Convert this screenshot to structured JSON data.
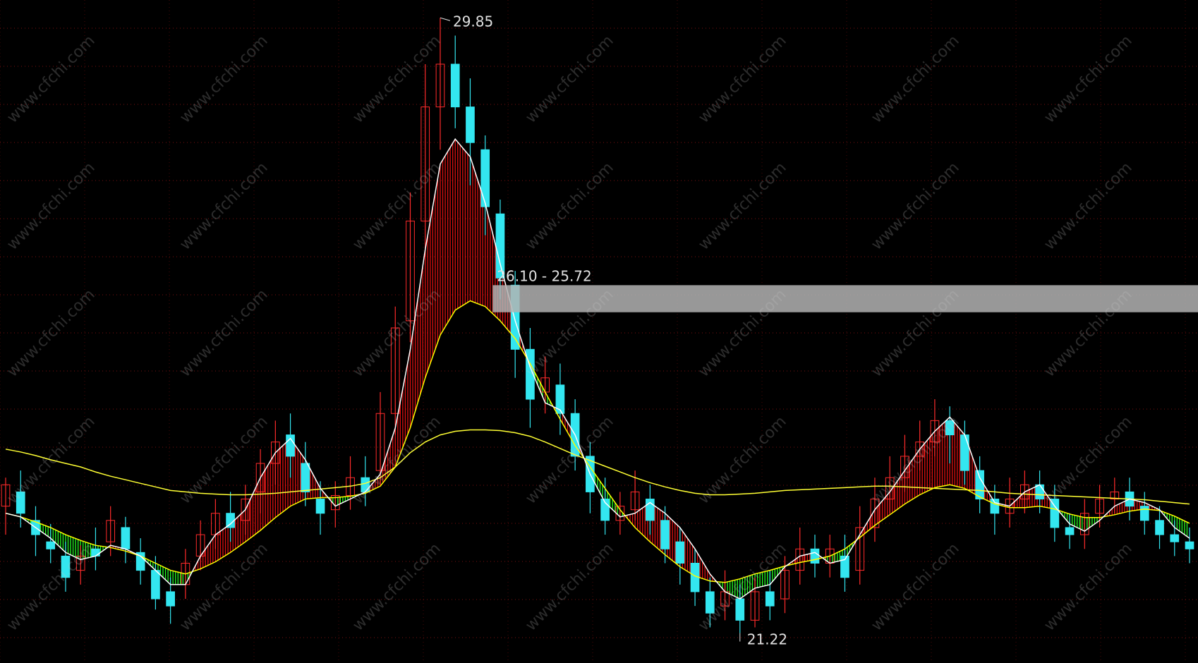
{
  "watermark": "www.cfchi.com",
  "colors": {
    "background": "#000000",
    "grid": "#7a1010",
    "up_candle": "#ff2b2b",
    "down_candle": "#33e6f0",
    "ma_fast": "#ffffff",
    "ma_mid": "#ffff00",
    "ma_slow": "#ffff33",
    "fill_up": "#e01010",
    "fill_down": "#22ff22",
    "zone": "#b3b3b3",
    "label": "#e0e0e0"
  },
  "chart_data": {
    "type": "candlestick",
    "price_range": [
      20.8,
      30.1
    ],
    "annotations": {
      "high": "29.85",
      "low": "21.22",
      "zone": "26.10 - 25.72"
    },
    "zone": {
      "low": 25.72,
      "high": 26.1
    },
    "fast_ma": [
      22.9,
      22.85,
      22.7,
      22.55,
      22.35,
      22.25,
      22.3,
      22.45,
      22.4,
      22.3,
      22.1,
      21.9,
      21.9,
      22.3,
      22.6,
      22.75,
      22.95,
      23.4,
      23.75,
      23.95,
      23.65,
      23.25,
      23.0,
      23.1,
      23.2,
      23.45,
      24.1,
      25.2,
      26.6,
      27.8,
      28.15,
      27.9,
      27.25,
      26.4,
      25.6,
      24.95,
      24.45,
      24.35,
      24.0,
      23.45,
      23.05,
      22.85,
      22.9,
      23.05,
      22.9,
      22.7,
      22.4,
      22.05,
      21.8,
      21.7,
      21.85,
      21.9,
      22.15,
      22.3,
      22.35,
      22.2,
      22.25,
      22.6,
      22.95,
      23.2,
      23.5,
      23.8,
      24.05,
      24.25,
      24.0,
      23.4,
      23.05,
      23.0,
      23.2,
      23.3,
      23.0,
      22.75,
      22.65,
      22.8,
      23.0,
      23.1,
      23.05,
      22.95,
      22.7,
      22.55
    ],
    "mid_ma": [
      22.9,
      22.85,
      22.78,
      22.7,
      22.6,
      22.52,
      22.45,
      22.42,
      22.37,
      22.3,
      22.2,
      22.1,
      22.05,
      22.12,
      22.22,
      22.35,
      22.5,
      22.66,
      22.84,
      23.0,
      23.1,
      23.12,
      23.12,
      23.14,
      23.18,
      23.28,
      23.55,
      24.1,
      24.8,
      25.4,
      25.75,
      25.88,
      25.8,
      25.6,
      25.35,
      25.0,
      24.6,
      24.22,
      23.85,
      23.55,
      23.25,
      22.95,
      22.7,
      22.5,
      22.32,
      22.15,
      22.02,
      21.95,
      21.93,
      21.98,
      22.05,
      22.1,
      22.16,
      22.21,
      22.25,
      22.3,
      22.4,
      22.56,
      22.73,
      22.88,
      23.03,
      23.16,
      23.26,
      23.3,
      23.25,
      23.13,
      23.03,
      22.98,
      22.98,
      23.0,
      22.96,
      22.89,
      22.84,
      22.84,
      22.88,
      22.93,
      22.96,
      22.94,
      22.86,
      22.76
    ],
    "slow_ma": [
      23.8,
      23.76,
      23.71,
      23.65,
      23.6,
      23.55,
      23.48,
      23.42,
      23.37,
      23.32,
      23.27,
      23.22,
      23.2,
      23.18,
      23.17,
      23.16,
      23.16,
      23.17,
      23.18,
      23.2,
      23.22,
      23.24,
      23.26,
      23.28,
      23.32,
      23.4,
      23.55,
      23.75,
      23.9,
      24.0,
      24.05,
      24.07,
      24.07,
      24.06,
      24.03,
      23.98,
      23.9,
      23.81,
      23.72,
      23.64,
      23.56,
      23.48,
      23.4,
      23.33,
      23.27,
      23.22,
      23.18,
      23.16,
      23.16,
      23.17,
      23.18,
      23.2,
      23.22,
      23.23,
      23.24,
      23.25,
      23.26,
      23.27,
      23.28,
      23.28,
      23.27,
      23.26,
      23.25,
      23.24,
      23.23,
      23.22,
      23.2,
      23.18,
      23.17,
      23.16,
      23.15,
      23.14,
      23.13,
      23.12,
      23.11,
      23.1,
      23.09,
      23.07,
      23.05,
      23.03
    ],
    "candles": [
      [
        23.0,
        23.3,
        23.4,
        22.6
      ],
      [
        23.2,
        22.9,
        23.5,
        22.7
      ],
      [
        22.8,
        22.6,
        23.0,
        22.3
      ],
      [
        22.5,
        22.4,
        22.75,
        22.2
      ],
      [
        22.3,
        22.0,
        22.5,
        21.8
      ],
      [
        22.1,
        22.3,
        22.45,
        21.9
      ],
      [
        22.4,
        22.3,
        22.7,
        22.1
      ],
      [
        22.5,
        22.8,
        23.0,
        22.3
      ],
      [
        22.7,
        22.4,
        22.85,
        22.2
      ],
      [
        22.35,
        22.1,
        22.55,
        21.9
      ],
      [
        22.1,
        21.7,
        22.3,
        21.55
      ],
      [
        21.8,
        21.6,
        22.0,
        21.35
      ],
      [
        21.9,
        22.2,
        22.4,
        21.7
      ],
      [
        22.3,
        22.6,
        22.8,
        22.1
      ],
      [
        22.6,
        22.9,
        23.1,
        22.4
      ],
      [
        22.9,
        22.7,
        23.2,
        22.5
      ],
      [
        22.8,
        23.1,
        23.3,
        22.6
      ],
      [
        23.2,
        23.6,
        23.8,
        22.9
      ],
      [
        23.6,
        23.9,
        24.2,
        23.3
      ],
      [
        24.0,
        23.7,
        24.3,
        23.4
      ],
      [
        23.6,
        23.2,
        23.9,
        23.0
      ],
      [
        23.1,
        22.9,
        23.35,
        22.6
      ],
      [
        22.95,
        23.15,
        23.35,
        22.7
      ],
      [
        23.15,
        23.4,
        23.7,
        22.95
      ],
      [
        23.4,
        23.2,
        23.7,
        23.0
      ],
      [
        23.5,
        24.3,
        24.6,
        23.3
      ],
      [
        24.3,
        25.5,
        25.8,
        24.0
      ],
      [
        25.6,
        27.0,
        27.4,
        25.3
      ],
      [
        27.0,
        28.6,
        29.2,
        26.5
      ],
      [
        28.6,
        29.2,
        29.85,
        28.0
      ],
      [
        29.2,
        28.6,
        29.6,
        28.3
      ],
      [
        28.6,
        28.1,
        29.0,
        27.5
      ],
      [
        28.0,
        27.2,
        28.2,
        26.8
      ],
      [
        27.1,
        26.2,
        27.3,
        25.9
      ],
      [
        26.1,
        25.2,
        26.3,
        24.8
      ],
      [
        25.2,
        24.5,
        25.5,
        24.1
      ],
      [
        24.6,
        24.8,
        25.1,
        24.3
      ],
      [
        24.7,
        24.3,
        25.0,
        24.0
      ],
      [
        24.3,
        23.7,
        24.5,
        23.5
      ],
      [
        23.7,
        23.2,
        23.9,
        22.9
      ],
      [
        23.1,
        22.8,
        23.4,
        22.6
      ],
      [
        22.8,
        23.0,
        23.2,
        22.6
      ],
      [
        22.95,
        23.2,
        23.5,
        22.8
      ],
      [
        23.1,
        22.8,
        23.3,
        22.6
      ],
      [
        22.8,
        22.4,
        23.0,
        22.2
      ],
      [
        22.5,
        22.2,
        22.7,
        21.9
      ],
      [
        22.2,
        21.8,
        22.4,
        21.6
      ],
      [
        21.8,
        21.5,
        22.0,
        21.3
      ],
      [
        21.6,
        21.8,
        22.1,
        21.4
      ],
      [
        21.7,
        21.4,
        21.9,
        21.22
      ],
      [
        21.4,
        21.8,
        22.0,
        21.3
      ],
      [
        21.8,
        21.6,
        22.1,
        21.4
      ],
      [
        21.7,
        22.1,
        22.3,
        21.5
      ],
      [
        22.1,
        22.4,
        22.7,
        21.9
      ],
      [
        22.4,
        22.2,
        22.6,
        22.0
      ],
      [
        22.2,
        22.4,
        22.6,
        22.0
      ],
      [
        22.3,
        22.0,
        22.6,
        21.8
      ],
      [
        22.1,
        22.7,
        23.0,
        21.9
      ],
      [
        22.7,
        23.1,
        23.4,
        22.5
      ],
      [
        23.1,
        23.4,
        23.7,
        22.9
      ],
      [
        23.4,
        23.7,
        24.0,
        23.2
      ],
      [
        23.7,
        23.9,
        24.2,
        23.5
      ],
      [
        23.9,
        24.2,
        24.5,
        23.7
      ],
      [
        24.2,
        24.0,
        24.4,
        23.6
      ],
      [
        24.0,
        23.5,
        24.2,
        23.3
      ],
      [
        23.5,
        23.1,
        23.7,
        22.9
      ],
      [
        23.1,
        22.9,
        23.3,
        22.6
      ],
      [
        22.9,
        23.1,
        23.4,
        22.7
      ],
      [
        23.1,
        23.3,
        23.5,
        22.9
      ],
      [
        23.3,
        23.1,
        23.5,
        22.9
      ],
      [
        23.1,
        22.7,
        23.3,
        22.5
      ],
      [
        22.7,
        22.6,
        22.9,
        22.4
      ],
      [
        22.6,
        22.9,
        23.1,
        22.4
      ],
      [
        22.9,
        23.1,
        23.3,
        22.7
      ],
      [
        23.1,
        23.2,
        23.4,
        22.9
      ],
      [
        23.2,
        23.0,
        23.4,
        22.8
      ],
      [
        23.0,
        22.8,
        23.2,
        22.6
      ],
      [
        22.8,
        22.6,
        23.0,
        22.4
      ],
      [
        22.6,
        22.5,
        22.8,
        22.3
      ],
      [
        22.5,
        22.4,
        22.7,
        22.2
      ]
    ]
  }
}
